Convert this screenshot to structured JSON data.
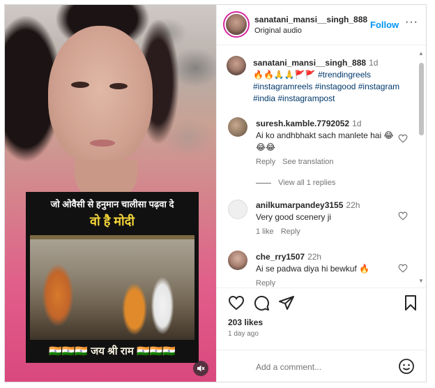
{
  "media": {
    "poster_line1": "जो ओवैसी से हनुमान चालीसा पढ़वा दे",
    "poster_line2": "वो है मोदी",
    "poster_line3": "🇮🇳🇮🇳🇮🇳 जय श्री राम 🇮🇳🇮🇳🇮🇳",
    "mute_icon": "speaker-muted-icon"
  },
  "header": {
    "username": "sanatani_mansi__singh_888",
    "subtitle": "Original audio",
    "follow_label": "Follow",
    "more_label": "···"
  },
  "caption": {
    "username": "sanatani_mansi__singh_888",
    "ago": "1d",
    "emoji_line": "🔥🔥🙏🙏🚩🚩 ",
    "hashtags": "#trendingreels #instagramreels #instagood #instagram #india #instagrampost"
  },
  "comments": [
    {
      "username": "suresh.kamble.7792052",
      "ago": "1d",
      "text": "Ai ko andhbhakt sach manlete hai 😂😂😂",
      "reply_label": "Reply",
      "translate_label": "See translation",
      "view_replies": "View all 1 replies"
    },
    {
      "username": "anilkumarpandey3155",
      "ago": "22h",
      "text": "Very good scenery ji",
      "likes_label": "1 like",
      "reply_label": "Reply"
    },
    {
      "username": "che_rry1507",
      "ago": "22h",
      "text": "Ai se padwa diya hi bewkuf 🔥",
      "reply_label": "Reply"
    }
  ],
  "actions": {
    "icons": [
      "heart-icon",
      "comment-icon",
      "share-icon",
      "save-icon"
    ],
    "likes": "203 likes",
    "when": "1 day ago"
  },
  "add_comment": {
    "placeholder": "Add a comment...",
    "emoji_icon": "smiley-icon"
  },
  "colors": {
    "link_blue": "#0095f6",
    "hashtag": "#00376b",
    "muted": "#737373"
  }
}
